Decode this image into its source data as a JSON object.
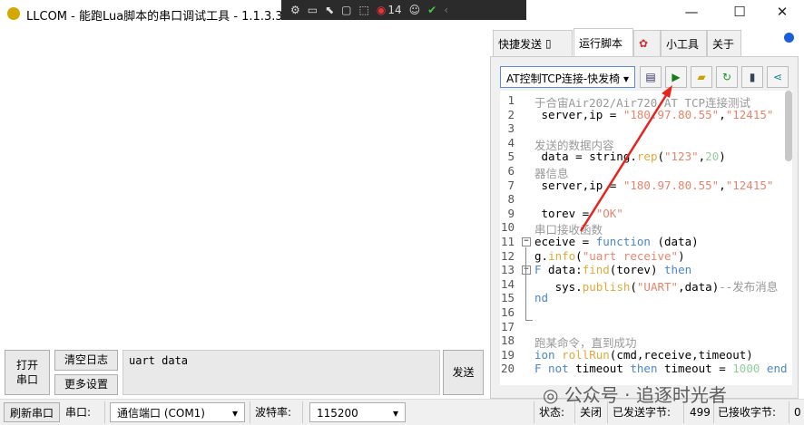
{
  "window": {
    "title": "LLCOM - 能跑Lua脚本的串口调试工具 - 1.1.3.3",
    "minimize": "—",
    "maximize": "☐",
    "close": "✕"
  },
  "overlay_toolbar": {
    "badge_count": "14"
  },
  "tabs": [
    {
      "label": "快捷发送"
    },
    {
      "label": "运行脚本"
    },
    {
      "label": ""
    },
    {
      "label": "小工具"
    },
    {
      "label": "关于"
    }
  ],
  "script": {
    "selected": "AT控制TCP连接-快发椅"
  },
  "code_lines": [
    [
      [
        "comment",
        "于合宙Air202/Air720 AT TCP连接测试"
      ]
    ],
    [
      [
        "plain",
        " server,ip = "
      ],
      [
        "string",
        "\"180.97.80.55\""
      ],
      [
        "plain",
        ","
      ],
      [
        "string",
        "\"12415\""
      ]
    ],
    [],
    [
      [
        "comment",
        "发送的数据内容"
      ]
    ],
    [
      [
        "plain",
        " data = string."
      ],
      [
        "func",
        "rep"
      ],
      [
        "plain",
        "("
      ],
      [
        "string",
        "\"123\""
      ],
      [
        "plain",
        ","
      ],
      [
        "number",
        "20"
      ],
      [
        "plain",
        ")"
      ]
    ],
    [
      [
        "comment",
        "器信息"
      ]
    ],
    [
      [
        "plain",
        " server,ip = "
      ],
      [
        "string",
        "\"180.97.80.55\""
      ],
      [
        "plain",
        ","
      ],
      [
        "string",
        "\"12415\""
      ]
    ],
    [],
    [
      [
        "plain",
        " torev = "
      ],
      [
        "string",
        "\"OK\""
      ]
    ],
    [
      [
        "comment",
        "串口接收函数"
      ]
    ],
    [
      [
        "plain",
        "eceive = "
      ],
      [
        "keyword",
        "function"
      ],
      [
        "plain",
        " (data)"
      ]
    ],
    [
      [
        "plain",
        "g."
      ],
      [
        "func",
        "info"
      ],
      [
        "plain",
        "("
      ],
      [
        "string",
        "\"uart receive\""
      ],
      [
        "plain",
        ")"
      ]
    ],
    [
      [
        "keyword",
        "F"
      ],
      [
        "plain",
        " data:"
      ],
      [
        "func",
        "find"
      ],
      [
        "plain",
        "(torev) "
      ],
      [
        "keyword",
        "then"
      ]
    ],
    [
      [
        "plain",
        "   sys."
      ],
      [
        "func",
        "publish"
      ],
      [
        "plain",
        "("
      ],
      [
        "string",
        "\"UART\""
      ],
      [
        "plain",
        ",data)"
      ],
      [
        "comment",
        "--发布消息"
      ]
    ],
    [
      [
        "keyword",
        "nd"
      ]
    ],
    [],
    [],
    [
      [
        "comment",
        "跑某命令，直到成功"
      ]
    ],
    [
      [
        "keyword",
        "ion "
      ],
      [
        "func",
        "rollRun"
      ],
      [
        "plain",
        "(cmd,receive,timeout)"
      ]
    ],
    [
      [
        "keyword",
        "F not"
      ],
      [
        "plain",
        " timeout "
      ],
      [
        "keyword",
        "then"
      ],
      [
        "plain",
        " timeout = "
      ],
      [
        "number",
        "1000"
      ],
      [
        "keyword",
        " end"
      ]
    ]
  ],
  "controls": {
    "open_port": "打开\n串口",
    "clear_log": "清空日志",
    "more_settings": "更多设置",
    "send_input": "uart data",
    "send": "发送"
  },
  "statusbar": {
    "refresh": "刷新串口",
    "port_label": "串口:",
    "port_value": "通信端口 (COM1)",
    "baud_label": "波特率:",
    "baud_value": "115200",
    "status_label": "状态:",
    "status_value": "关闭",
    "sent_label": "已发送字节:",
    "sent_value": "499",
    "recv_label": "已接收字节:",
    "recv_value": "0"
  },
  "watermark": "公众号 · 追逐时光者"
}
